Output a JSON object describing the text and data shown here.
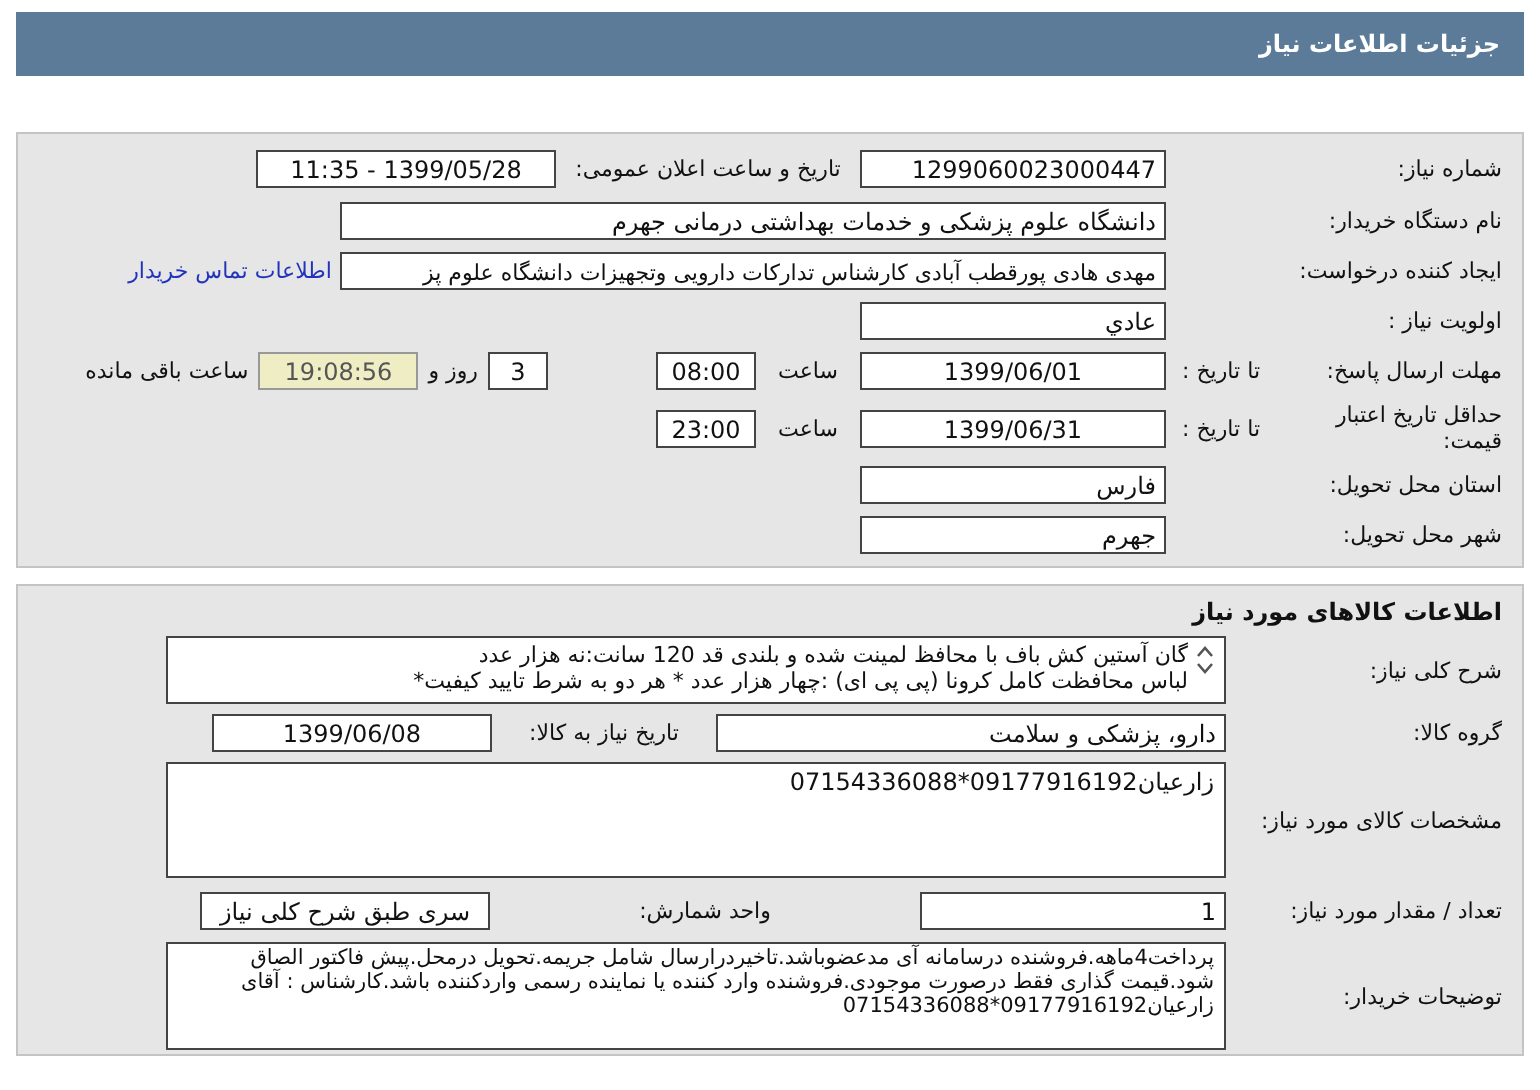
{
  "header": {
    "title": "جزئیات اطلاعات نیاز"
  },
  "need_number": {
    "label": "شماره نیاز:",
    "value": "1299060023000447"
  },
  "announce": {
    "label": "تاریخ و ساعت اعلان عمومی:",
    "value": "1399/05/28 - 11:35"
  },
  "buyer": {
    "label": "نام دستگاه خریدار:",
    "value": "دانشگاه علوم پزشکی و خدمات بهداشتی درمانی جهرم"
  },
  "creator": {
    "label": "ایجاد کننده درخواست:",
    "value": "مهدی هادی پورقطب آبادی کارشناس تدارکات دارویی وتجهیزات دانشگاه علوم پز",
    "link": "اطلاعات تماس خریدار"
  },
  "priority": {
    "label": "اولویت نیاز :",
    "value": "عادي"
  },
  "deadline": {
    "label": "مهلت ارسال پاسخ:",
    "date_label": "تا تاریخ :",
    "date": "1399/06/01",
    "time_label": "ساعت",
    "time": "08:00",
    "days": "3",
    "days_label": "روز و",
    "remaining": "19:08:56",
    "remaining_label": "ساعت باقی مانده"
  },
  "validity": {
    "label": "حداقل تاریخ اعتبار قیمت:",
    "date_label": "تا تاریخ :",
    "date": "1399/06/31",
    "time_label": "ساعت",
    "time": "23:00"
  },
  "province": {
    "label": "استان محل تحویل:",
    "value": "فارس"
  },
  "city": {
    "label": "شهر محل تحویل:",
    "value": "جهرم"
  },
  "goods": {
    "title": "اطلاعات کالاهای مورد نیاز",
    "description": {
      "label": "شرح کلی نیاز:",
      "lines": [
        "گان آستین کش باف با محافظ لمینت شده و بلندی قد 120 سانت:نه هزار عدد",
        "لباس محافظت کامل کرونا (پی پی ای) :چهار هزار عدد  * هر دو به شرط تایید کیفیت*"
      ]
    },
    "group": {
      "label": "گروه کالا:",
      "value": "دارو، پزشکی و سلامت"
    },
    "need_date": {
      "label": "تاریخ نیاز به کالا:",
      "value": "1399/06/08"
    },
    "specs": {
      "label": "مشخصات کالای مورد نیاز:",
      "value": "زارعیان09177916192*07154336088"
    },
    "quantity": {
      "label": "تعداد / مقدار مورد نیاز:",
      "value": "1"
    },
    "unit": {
      "label": "واحد شمارش:",
      "value": "سری طبق شرح کلی نیاز"
    },
    "notes": {
      "label": "توضیحات خریدار:",
      "value": "پرداخت4ماهه.فروشنده درسامانه آی مدعضوباشد.تاخیردرارسال شامل جریمه.تحویل درمحل.پیش فاکتور الصاق شود.قیمت گذاری فقط درصورت موجودی.فروشنده وارد کننده یا نماینده رسمی واردکننده باشد.کارشناس : آقای زارعیان09177916192*07154336088"
    }
  }
}
